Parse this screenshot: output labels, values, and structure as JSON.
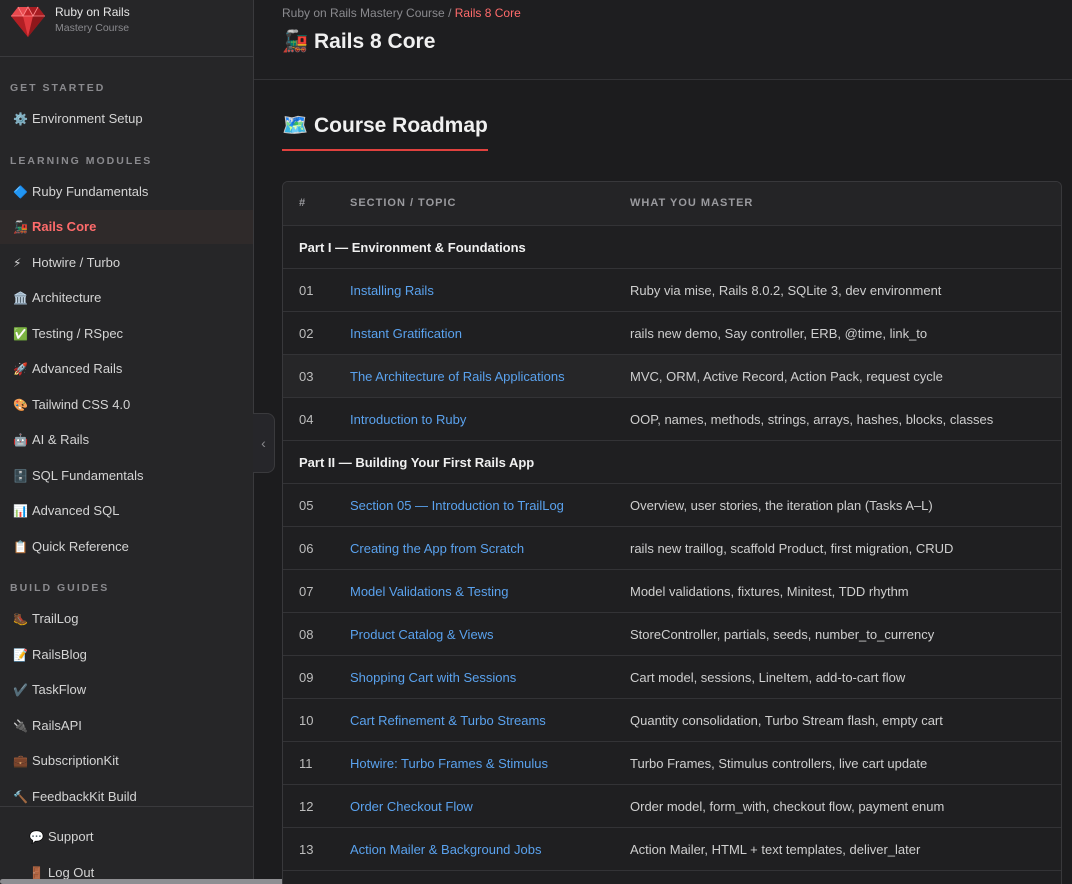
{
  "brand": {
    "title": "Ruby on Rails",
    "subtitle": "Mastery Course"
  },
  "sidebar": {
    "sections": [
      {
        "label": "GET STARTED",
        "items": [
          {
            "icon": "⚙️",
            "label": "Environment Setup"
          }
        ]
      },
      {
        "label": "LEARNING MODULES",
        "items": [
          {
            "icon": "🔷",
            "label": "Ruby Fundamentals"
          },
          {
            "icon": "🚂",
            "label": "Rails Core",
            "active": true
          },
          {
            "icon": "⚡",
            "label": "Hotwire / Turbo"
          },
          {
            "icon": "🏛️",
            "label": "Architecture"
          },
          {
            "icon": "✅",
            "label": "Testing / RSpec"
          },
          {
            "icon": "🚀",
            "label": "Advanced Rails"
          },
          {
            "icon": "🎨",
            "label": "Tailwind CSS 4.0"
          },
          {
            "icon": "🤖",
            "label": "AI & Rails"
          },
          {
            "icon": "🗄️",
            "label": "SQL Fundamentals"
          },
          {
            "icon": "📊",
            "label": "Advanced SQL"
          },
          {
            "icon": "📋",
            "label": "Quick Reference"
          }
        ]
      },
      {
        "label": "BUILD GUIDES",
        "items": [
          {
            "icon": "🥾",
            "label": "TrailLog"
          },
          {
            "icon": "📝",
            "label": "RailsBlog"
          },
          {
            "icon": "✔️",
            "label": "TaskFlow"
          },
          {
            "icon": "🔌",
            "label": "RailsAPI"
          },
          {
            "icon": "💼",
            "label": "SubscriptionKit"
          },
          {
            "icon": "🔨",
            "label": "FeedbackKit Build"
          }
        ]
      }
    ],
    "footer": [
      {
        "icon": "💬",
        "label": "Support"
      },
      {
        "icon": "🚪",
        "label": "Log Out"
      }
    ],
    "collapse_glyph": "‹"
  },
  "header": {
    "breadcrumb_root": "Ruby on Rails Mastery Course",
    "breadcrumb_sep": " / ",
    "breadcrumb_current": "Rails 8 Core",
    "title_icon": "🚂",
    "title": "Rails 8 Core"
  },
  "roadmap": {
    "icon": "🗺️",
    "heading": "Course Roadmap",
    "columns": [
      "#",
      "SECTION / TOPIC",
      "WHAT YOU MASTER"
    ],
    "rows": [
      {
        "type": "part",
        "label": "Part I — Environment & Foundations"
      },
      {
        "type": "item",
        "num": "01",
        "topic": "Installing Rails",
        "master": "Ruby via mise, Rails 8.0.2, SQLite 3, dev environment"
      },
      {
        "type": "item",
        "num": "02",
        "topic": "Instant Gratification",
        "master": "rails new demo, Say controller, ERB, @time, link_to"
      },
      {
        "type": "item",
        "num": "03",
        "topic": "The Architecture of Rails Applications",
        "master": "MVC, ORM, Active Record, Action Pack, request cycle",
        "highlight": true
      },
      {
        "type": "item",
        "num": "04",
        "topic": "Introduction to Ruby",
        "master": "OOP, names, methods, strings, arrays, hashes, blocks, classes"
      },
      {
        "type": "part",
        "label": "Part II — Building Your First Rails App"
      },
      {
        "type": "item",
        "num": "05",
        "topic": "Section 05 — Introduction to TrailLog",
        "master": "Overview, user stories, the iteration plan (Tasks A–L)"
      },
      {
        "type": "item",
        "num": "06",
        "topic": "Creating the App from Scratch",
        "master": "rails new traillog, scaffold Product, first migration, CRUD"
      },
      {
        "type": "item",
        "num": "07",
        "topic": "Model Validations & Testing",
        "master": "Model validations, fixtures, Minitest, TDD rhythm"
      },
      {
        "type": "item",
        "num": "08",
        "topic": "Product Catalog & Views",
        "master": "StoreController, partials, seeds, number_to_currency"
      },
      {
        "type": "item",
        "num": "09",
        "topic": "Shopping Cart with Sessions",
        "master": "Cart model, sessions, LineItem, add-to-cart flow"
      },
      {
        "type": "item",
        "num": "10",
        "topic": "Cart Refinement & Turbo Streams",
        "master": "Quantity consolidation, Turbo Stream flash, empty cart"
      },
      {
        "type": "item",
        "num": "11",
        "topic": "Hotwire: Turbo Frames & Stimulus",
        "master": "Turbo Frames, Stimulus controllers, live cart update"
      },
      {
        "type": "item",
        "num": "12",
        "topic": "Order Checkout Flow",
        "master": "Order model, form_with, checkout flow, payment enum"
      },
      {
        "type": "item",
        "num": "13",
        "topic": "Action Mailer & Background Jobs",
        "master": "Action Mailer, HTML + text templates, deliver_later"
      }
    ]
  }
}
